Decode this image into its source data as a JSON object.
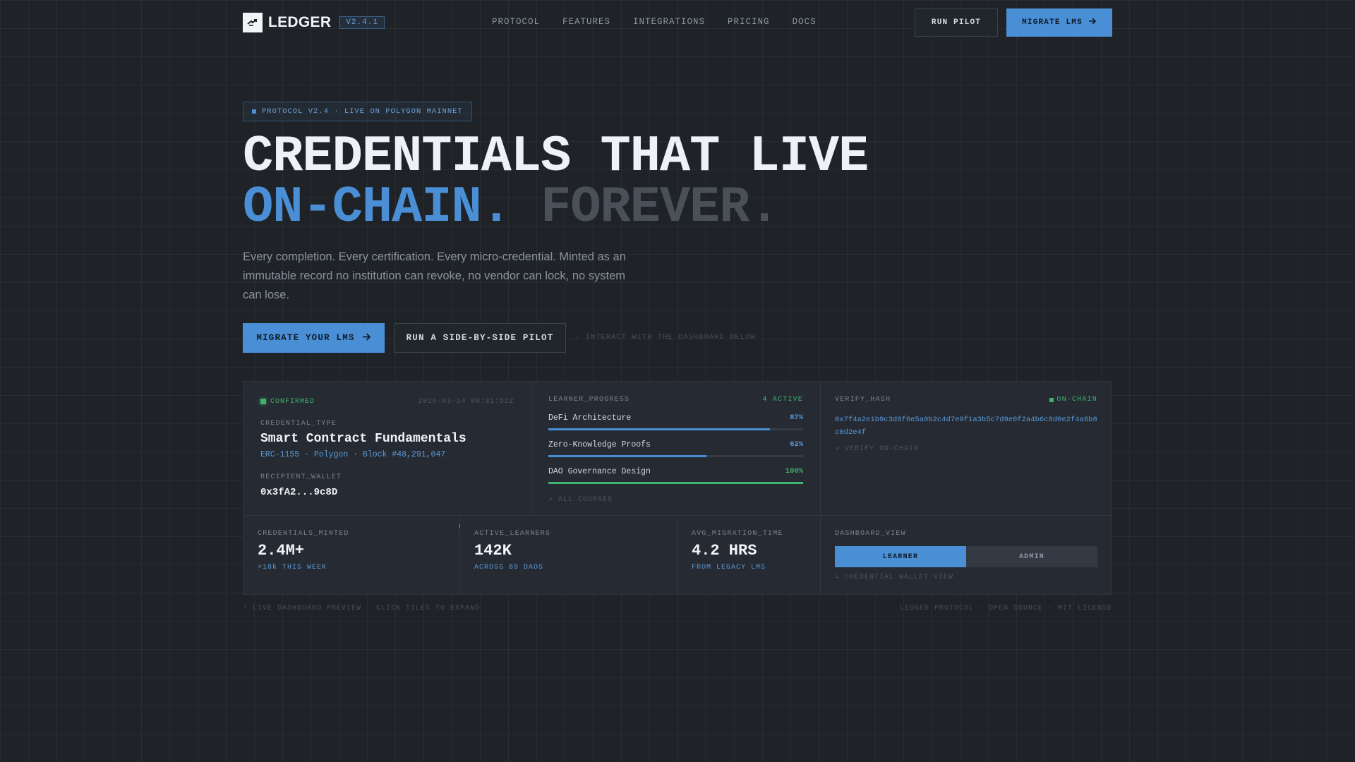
{
  "brand": {
    "name": "LEDGER",
    "version": "V2.4.1"
  },
  "nav": {
    "links": [
      "PROTOCOL",
      "FEATURES",
      "INTEGRATIONS",
      "PRICING",
      "DOCS"
    ],
    "pilot_label": "RUN PILOT",
    "migrate_label": "MIGRATE LMS"
  },
  "hero": {
    "badge": "PROTOCOL V2.4 · LIVE ON POLYGON MAINNET",
    "line1": "CREDENTIALS THAT LIVE",
    "line2a": "ON-CHAIN.",
    "line2b": "FOREVER.",
    "subtitle": "Every completion. Every certification. Every micro-credential. Minted as an immutable record no institution can revoke, no vendor can lock, no system can lose.",
    "cta_primary": "MIGRATE YOUR LMS",
    "cta_secondary": "RUN A SIDE-BY-SIDE PILOT",
    "hint": "↓ INTERACT WITH THE DASHBOARD BELOW"
  },
  "credential": {
    "status": "CONFIRMED",
    "timestamp": "2026-03-14 09:31:52Z",
    "type_label": "CREDENTIAL_TYPE",
    "title": "Smart Contract Fundamentals",
    "meta": "ERC-1155 · Polygon · Block #48,291,047",
    "wallet_label": "RECIPIENT_WALLET",
    "wallet": "0x3fA2...9c8D"
  },
  "progress": {
    "label": "LEARNER_PROGRESS",
    "active": "4 ACTIVE",
    "courses": [
      {
        "name": "DeFi Architecture",
        "pct_text": "87%",
        "value": 0.87,
        "color": "#4a8fd6"
      },
      {
        "name": "Zero-Knowledge Proofs",
        "pct_text": "62%",
        "value": 0.62,
        "color": "#4a8fd6"
      },
      {
        "name": "DAO Governance Design",
        "pct_text": "100%",
        "value": 1.0,
        "color": "#3fb36b"
      }
    ],
    "all_link": "↗ ALL COURSES"
  },
  "verify": {
    "label": "VERIFY_HASH",
    "status": "ON-CHAIN",
    "hash": "0x7f4a2e1b9c3d8f6e5a0b2c4d7e9f1a3b5c7d9e0f2a4b6c8d0e2f4a6b8c0d2e4f",
    "link": "↗ VERIFY ON-CHAIN"
  },
  "stats": [
    {
      "label": "CREDENTIALS_MINTED",
      "value": "2.4M+",
      "sub": "+18k THIS WEEK"
    },
    {
      "label": "ACTIVE_LEARNERS",
      "value": "142K",
      "sub": "ACROSS 89 DAOS"
    },
    {
      "label": "AVG_MIGRATION_TIME",
      "value": "4.2 HRS",
      "sub": "FROM LEGACY LMS"
    }
  ],
  "view": {
    "label": "DASHBOARD_VIEW",
    "options": [
      "LEARNER",
      "ADMIN"
    ],
    "selected": "LEARNER",
    "caption": "↳ CREDENTIAL WALLET VIEW"
  },
  "footer": {
    "left": "↑ LIVE DASHBOARD PREVIEW · CLICK TILES TO EXPAND",
    "right": "LEDGER PROTOCOL · OPEN SOURCE · MIT LICENSE"
  },
  "colors": {
    "accent": "#4a8fd6",
    "success": "#3fb36b",
    "background": "#1f2328"
  }
}
